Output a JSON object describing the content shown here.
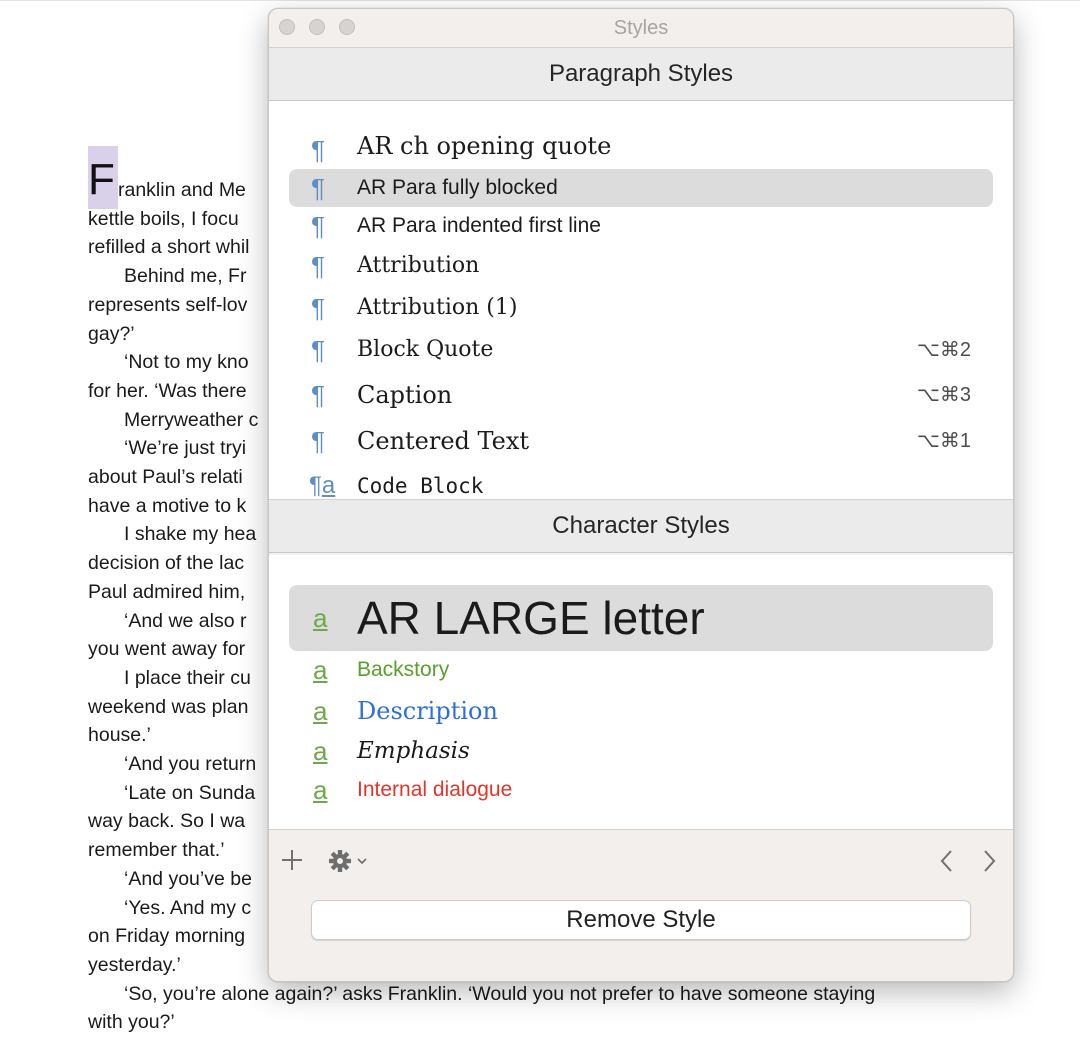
{
  "document": {
    "dropcap": "F",
    "lines": [
      {
        "text": "ranklin and Me",
        "indent": false
      },
      {
        "text": "kettle boils, I focu",
        "indent": false
      },
      {
        "text": "refilled a short whil",
        "indent": false
      },
      {
        "text": "Behind me, Fr",
        "indent": true
      },
      {
        "text": "represents self-lov",
        "indent": false
      },
      {
        "text": "gay?’",
        "indent": false
      },
      {
        "text": "‘Not to my kno",
        "indent": true
      },
      {
        "text": "for her. ‘Was there",
        "indent": false
      },
      {
        "text": "Merryweather c",
        "indent": true
      },
      {
        "text": "‘We’re just tryi",
        "indent": true
      },
      {
        "text": "about Paul’s relati",
        "indent": false
      },
      {
        "text": "have a motive to k",
        "indent": false
      },
      {
        "text": "I shake my hea",
        "indent": true
      },
      {
        "text": "decision of the lac",
        "indent": false
      },
      {
        "text": "Paul admired him,",
        "indent": false
      },
      {
        "text": "‘And we also r",
        "indent": true
      },
      {
        "text": "you went away for",
        "indent": false
      },
      {
        "text": "I place their cu",
        "indent": true
      },
      {
        "text": "weekend was plan",
        "indent": false
      },
      {
        "text": "house.’",
        "indent": false
      },
      {
        "text": "‘And you return",
        "indent": true
      },
      {
        "text": "‘Late on Sunda",
        "indent": true
      },
      {
        "text": "way back. So I wa",
        "indent": false
      },
      {
        "text": "remember that.’",
        "indent": false
      },
      {
        "text": "‘And you’ve be",
        "indent": true
      },
      {
        "text": "‘Yes. And my c",
        "indent": true
      },
      {
        "text": "on Friday morning",
        "indent": false
      },
      {
        "text": "yesterday.’",
        "indent": false
      },
      {
        "text": "‘So, you’re alone again?’ asks Franklin. ‘Would you not prefer to have someone staying",
        "indent": true
      },
      {
        "text": "with you?’",
        "indent": false
      }
    ]
  },
  "panel": {
    "title": "Styles",
    "paragraph_header": "Paragraph Styles",
    "character_header": "Character Styles",
    "paragraph_styles": [
      {
        "name": "AR ch opening quote",
        "shortcut": "",
        "icon": "pilcrow-icon",
        "selected": false
      },
      {
        "name": "AR Para fully blocked",
        "shortcut": "",
        "icon": "pilcrow-icon",
        "selected": true
      },
      {
        "name": "AR Para indented first line",
        "shortcut": "",
        "icon": "pilcrow-icon",
        "selected": false
      },
      {
        "name": "Attribution",
        "shortcut": "",
        "icon": "pilcrow-icon",
        "selected": false
      },
      {
        "name": "Attribution (1)",
        "shortcut": "",
        "icon": "pilcrow-icon",
        "selected": false
      },
      {
        "name": "Block Quote",
        "shortcut": "⌥⌘2",
        "icon": "pilcrow-icon",
        "selected": false
      },
      {
        "name": "Caption",
        "shortcut": "⌥⌘3",
        "icon": "pilcrow-icon",
        "selected": false
      },
      {
        "name": "Centered Text",
        "shortcut": "⌥⌘1",
        "icon": "pilcrow-icon",
        "selected": false
      },
      {
        "name": "Code Block",
        "shortcut": "",
        "icon": "pilcrow-char-icon",
        "selected": false
      }
    ],
    "character_styles": [
      {
        "name": "AR LARGE letter",
        "icon": "char-style-icon",
        "selected": true,
        "color": "#1b1b1b"
      },
      {
        "name": "Backstory",
        "icon": "char-style-icon",
        "selected": false,
        "color": "#5aa02c"
      },
      {
        "name": "Description",
        "icon": "char-style-icon",
        "selected": false,
        "color": "#2f6fdc"
      },
      {
        "name": "Emphasis",
        "icon": "char-style-icon",
        "selected": false,
        "color": "#1b1b1b"
      },
      {
        "name": "Internal dialogue",
        "icon": "char-style-icon",
        "selected": false,
        "color": "#e0352b"
      }
    ],
    "toolbar": {
      "add_icon": "plus-icon",
      "gear_icon": "gear-icon",
      "prev_icon": "chevron-left-icon",
      "next_icon": "chevron-right-icon"
    },
    "remove_button": "Remove Style"
  }
}
